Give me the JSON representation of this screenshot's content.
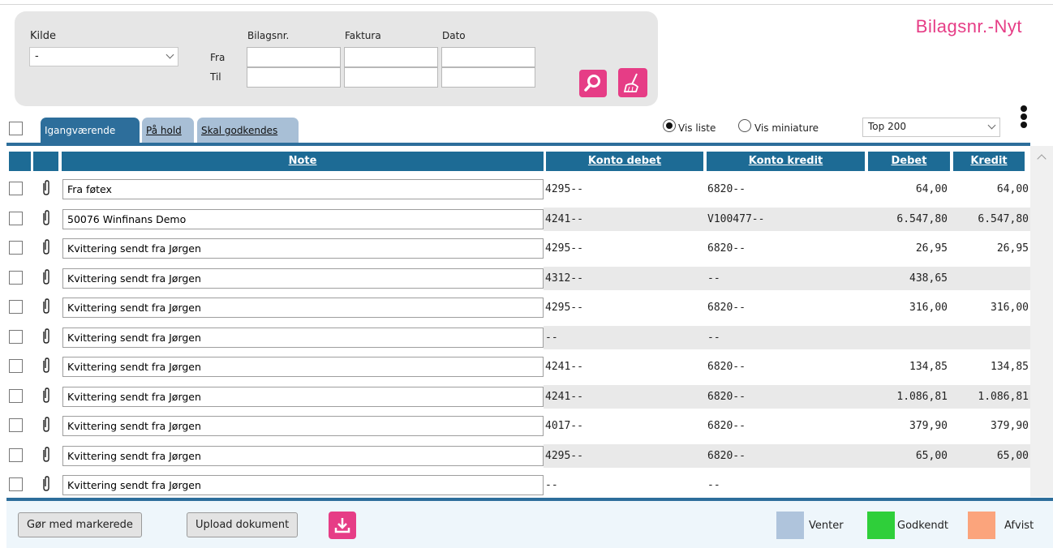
{
  "page": {
    "title": "Bilagsnr.-Nyt"
  },
  "filter": {
    "kilde_label": "Kilde",
    "kilde_value": "-",
    "bilagsnr_label": "Bilagsnr.",
    "faktura_label": "Faktura",
    "dato_label": "Dato",
    "fra_label": "Fra",
    "til_label": "Til",
    "search_icon": "search-icon",
    "clear_icon": "broom-icon"
  },
  "tabs": [
    {
      "label": "Igangværende",
      "active": true
    },
    {
      "label": "På hold",
      "active": false
    },
    {
      "label": "Skal godkendes",
      "active": false
    }
  ],
  "view": {
    "vis_liste": "Vis liste",
    "vis_miniature": "Vis miniature",
    "selected": "Vis liste",
    "top_select": "Top 200"
  },
  "columns": {
    "note": "Note",
    "konto_debet": "Konto debet",
    "konto_kredit": "Konto kredit",
    "debet": "Debet",
    "kredit": "Kredit"
  },
  "rows": [
    {
      "note": "Fra føtex",
      "konto_debet": "4295--",
      "konto_kredit": "6820--",
      "debet": "64,00",
      "kredit": "64,00"
    },
    {
      "note": "50076 Winfinans Demo",
      "konto_debet": "4241--",
      "konto_kredit": "V100477--",
      "debet": "6.547,80",
      "kredit": "6.547,80"
    },
    {
      "note": "Kvittering sendt fra Jørgen",
      "konto_debet": "4295--",
      "konto_kredit": "6820--",
      "debet": "26,95",
      "kredit": "26,95"
    },
    {
      "note": "Kvittering sendt fra Jørgen",
      "konto_debet": "4312--",
      "konto_kredit": "--",
      "debet": "438,65",
      "kredit": ""
    },
    {
      "note": "Kvittering sendt fra Jørgen",
      "konto_debet": "4295--",
      "konto_kredit": "6820--",
      "debet": "316,00",
      "kredit": "316,00"
    },
    {
      "note": "Kvittering sendt fra Jørgen",
      "konto_debet": "--",
      "konto_kredit": "--",
      "debet": "",
      "kredit": ""
    },
    {
      "note": "Kvittering sendt fra Jørgen",
      "konto_debet": "4241--",
      "konto_kredit": "6820--",
      "debet": "134,85",
      "kredit": "134,85"
    },
    {
      "note": "Kvittering sendt fra Jørgen",
      "konto_debet": "4241--",
      "konto_kredit": "6820--",
      "debet": "1.086,81",
      "kredit": "1.086,81"
    },
    {
      "note": "Kvittering sendt fra Jørgen",
      "konto_debet": "4017--",
      "konto_kredit": "6820--",
      "debet": "379,90",
      "kredit": "379,90"
    },
    {
      "note": "Kvittering sendt fra Jørgen",
      "konto_debet": "4295--",
      "konto_kredit": "6820--",
      "debet": "65,00",
      "kredit": "65,00"
    },
    {
      "note": "Kvittering sendt fra Jørgen",
      "konto_debet": "--",
      "konto_kredit": "--",
      "debet": "",
      "kredit": ""
    }
  ],
  "footer": {
    "gor_med_markerede": "Gør med markerede",
    "upload_dokument": "Upload dokument",
    "download_icon": "download-icon",
    "legend": [
      {
        "label": "Venter",
        "color": "#afc4dc"
      },
      {
        "label": "Godkendt",
        "color": "#2fcf3a"
      },
      {
        "label": "Afvist",
        "color": "#fba47c"
      }
    ]
  },
  "colors": {
    "accent": "#e63d86",
    "header_blue": "#1d6b95",
    "tab_inactive": "#a8bfd6"
  }
}
